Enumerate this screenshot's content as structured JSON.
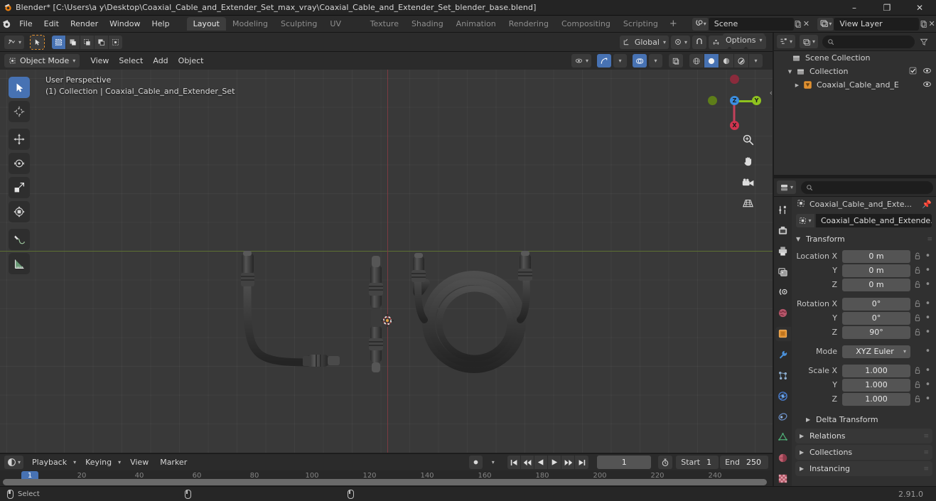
{
  "window": {
    "title": "Blender* [C:\\Users\\a y\\Desktop\\Coaxial_Cable_and_Extender_Set_max_vray\\Coaxial_Cable_and_Extender_Set_blender_base.blend]",
    "minimize": "–",
    "maximize": "❐",
    "close": "✕"
  },
  "topbar": {
    "menus": [
      "File",
      "Edit",
      "Render",
      "Window",
      "Help"
    ],
    "workspaces": [
      {
        "label": "Layout",
        "active": true
      },
      {
        "label": "Modeling",
        "active": false
      },
      {
        "label": "Sculpting",
        "active": false
      },
      {
        "label": "UV Editing",
        "active": false
      },
      {
        "label": "Texture Paint",
        "active": false
      },
      {
        "label": "Shading",
        "active": false
      },
      {
        "label": "Animation",
        "active": false
      },
      {
        "label": "Rendering",
        "active": false
      },
      {
        "label": "Compositing",
        "active": false
      },
      {
        "label": "Scripting",
        "active": false
      }
    ],
    "add_workspace": "+",
    "scene_name": "Scene",
    "view_layer_name": "View Layer"
  },
  "viewport_header": {
    "mode": "Object Mode",
    "menus": [
      "View",
      "Select",
      "Add",
      "Object"
    ],
    "transform_orientation": "Global",
    "options_label": "Options"
  },
  "viewport": {
    "perspective": "User Perspective",
    "collection_line": "(1) Collection | Coaxial_Cable_and_Extender_Set",
    "gizmo_axes": [
      "X",
      "Y",
      "Z"
    ],
    "tools": [
      {
        "name": "tweak-select-box",
        "active": true
      },
      {
        "name": "cursor",
        "active": false
      },
      {
        "name": "move",
        "active": false
      },
      {
        "name": "rotate",
        "active": false
      },
      {
        "name": "scale",
        "active": false
      },
      {
        "name": "transform",
        "active": false
      },
      {
        "name": "annotate",
        "active": false
      },
      {
        "name": "measure",
        "active": false
      }
    ]
  },
  "outliner": {
    "search_placeholder": "",
    "rows": [
      {
        "label": "Scene Collection",
        "indent": 0,
        "expand": "",
        "icon": "collection-icon",
        "checkbox": false,
        "eye": false
      },
      {
        "label": "Collection",
        "indent": 1,
        "expand": "▼",
        "icon": "collection-icon",
        "checkbox": true,
        "eye": true
      },
      {
        "label": "Coaxial_Cable_and_E",
        "indent": 2,
        "expand": "▶",
        "icon": "mesh-object-icon",
        "checkbox": false,
        "eye": true
      }
    ]
  },
  "properties": {
    "search_placeholder": "",
    "breadcrumb_object": "Coaxial_Cable_and_Exte...",
    "id_name": "Coaxial_Cable_and_Extende...",
    "tabs": [
      {
        "name": "tool",
        "active": false
      },
      {
        "name": "render",
        "active": false
      },
      {
        "name": "output",
        "active": false
      },
      {
        "name": "view-layer",
        "active": false
      },
      {
        "name": "scene",
        "active": false
      },
      {
        "name": "world",
        "active": false
      },
      {
        "name": "object",
        "active": true
      },
      {
        "name": "modifiers",
        "active": false
      },
      {
        "name": "particles",
        "active": false
      },
      {
        "name": "physics",
        "active": false
      },
      {
        "name": "constraints",
        "active": false
      },
      {
        "name": "object-data",
        "active": false
      },
      {
        "name": "material",
        "active": false
      },
      {
        "name": "texture",
        "active": false
      }
    ],
    "transform_panel": "Transform",
    "fields": [
      {
        "label": "Location X",
        "value": "0 m"
      },
      {
        "label": "Y",
        "value": "0 m"
      },
      {
        "label": "Z",
        "value": "0 m"
      },
      {
        "label": "Rotation X",
        "value": "0°"
      },
      {
        "label": "Y",
        "value": "0°"
      },
      {
        "label": "Z",
        "value": "90°"
      }
    ],
    "mode_label": "Mode",
    "mode_value": "XYZ Euler",
    "scale_fields": [
      {
        "label": "Scale X",
        "value": "1.000"
      },
      {
        "label": "Y",
        "value": "1.000"
      },
      {
        "label": "Z",
        "value": "1.000"
      }
    ],
    "sub_panels": [
      {
        "label": "Delta Transform",
        "nested": true
      },
      {
        "label": "Relations",
        "nested": false
      },
      {
        "label": "Collections",
        "nested": false
      },
      {
        "label": "Instancing",
        "nested": false
      }
    ]
  },
  "timeline": {
    "menus": [
      "Playback",
      "Keying",
      "View",
      "Marker"
    ],
    "current_frame": "1",
    "start_label": "Start",
    "start_value": "1",
    "end_label": "End",
    "end_value": "250",
    "playhead_frame": "1",
    "ticks": [
      "20",
      "40",
      "60",
      "80",
      "100",
      "120",
      "140",
      "160",
      "180",
      "200",
      "220",
      "240"
    ]
  },
  "statusbar": {
    "select_label": "Select",
    "version": "2.91.0"
  },
  "colors": {
    "accent_blue": "#4772b3",
    "active_orange": "#e09030",
    "axis_x": "#7c3b42",
    "axis_y": "#5c6f33",
    "panel_bg": "#303030",
    "header_bg": "#2b2b2b",
    "viewport_bg": "#393939"
  }
}
